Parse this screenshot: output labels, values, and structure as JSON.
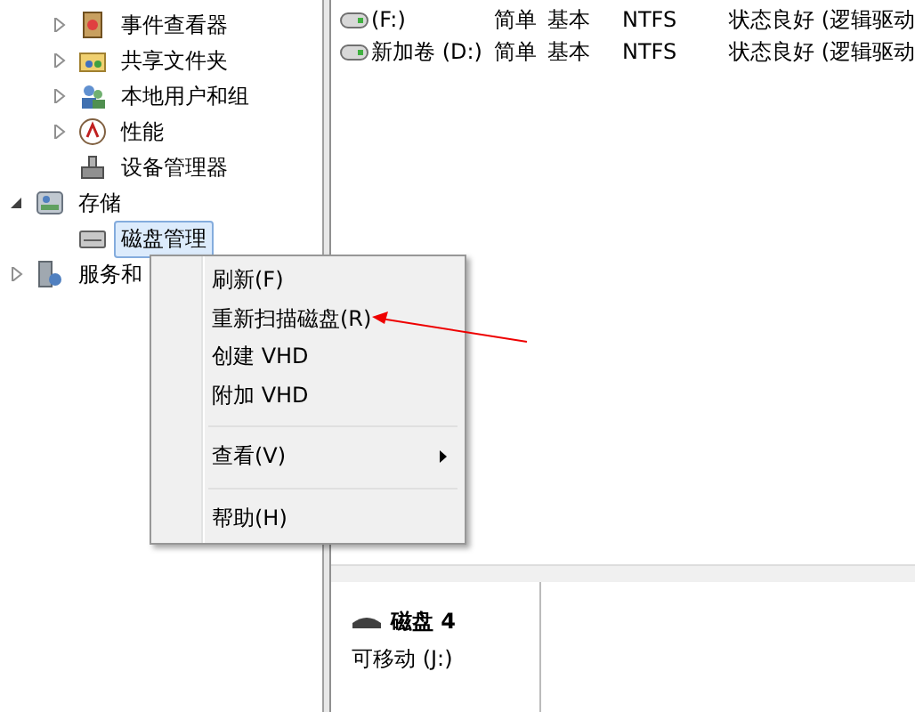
{
  "tree": [
    {
      "label": "事件查看器",
      "kind": "event",
      "expanded": false,
      "selected": false
    },
    {
      "label": "共享文件夹",
      "kind": "share",
      "expanded": false,
      "selected": false
    },
    {
      "label": "本地用户和组",
      "kind": "users",
      "expanded": false,
      "selected": false
    },
    {
      "label": "性能",
      "kind": "perf",
      "expanded": false,
      "selected": false
    },
    {
      "label": "设备管理器",
      "kind": "device",
      "selected": false
    },
    {
      "label": "存储",
      "kind": "storage",
      "expanded": true,
      "selected": false,
      "children": [
        {
          "label": "磁盘管理",
          "kind": "disk",
          "selected": true
        }
      ]
    },
    {
      "label": "服务和",
      "kind": "service",
      "expanded": false,
      "selected": false
    }
  ],
  "volumes": [
    {
      "name": "(F:)",
      "layout": "简单",
      "type": "基本",
      "fs": "NTFS",
      "status": "状态良好 (逻辑驱动"
    },
    {
      "name": "新加卷 (D:)",
      "layout": "简单",
      "type": "基本",
      "fs": "NTFS",
      "status": "状态良好 (逻辑驱动"
    }
  ],
  "disk": {
    "title": "磁盘 4",
    "subtitle": "可移动 (J:)"
  },
  "context_menu": [
    {
      "kind": "item",
      "label": "刷新(F)"
    },
    {
      "kind": "item",
      "label": "重新扫描磁盘(R)"
    },
    {
      "kind": "item",
      "label": "创建 VHD"
    },
    {
      "kind": "item",
      "label": "附加 VHD"
    },
    {
      "kind": "separator"
    },
    {
      "kind": "submenu",
      "label": "查看(V)"
    },
    {
      "kind": "separator"
    },
    {
      "kind": "item",
      "label": "帮助(H)"
    }
  ]
}
